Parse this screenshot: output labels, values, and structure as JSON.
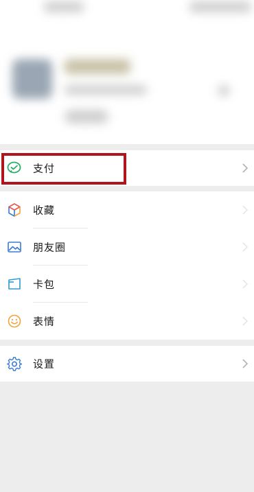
{
  "menu": {
    "pay": {
      "label": "支付",
      "icon": "wechat-pay-icon"
    },
    "favorites": {
      "label": "收藏",
      "icon": "favorites-cube-icon"
    },
    "moments": {
      "label": "朋友圈",
      "icon": "moments-picture-icon"
    },
    "cards": {
      "label": "卡包",
      "icon": "card-wallet-icon"
    },
    "stickers": {
      "label": "表情",
      "icon": "sticker-smile-icon"
    },
    "settings": {
      "label": "设置",
      "icon": "settings-gear-icon"
    }
  },
  "colors": {
    "highlight_border": "#b0141c",
    "pay_green": "#2aae67",
    "accent_blue": "#3a7bd5",
    "sticker_orange": "#f2a33a",
    "page_bg": "#ededed"
  }
}
